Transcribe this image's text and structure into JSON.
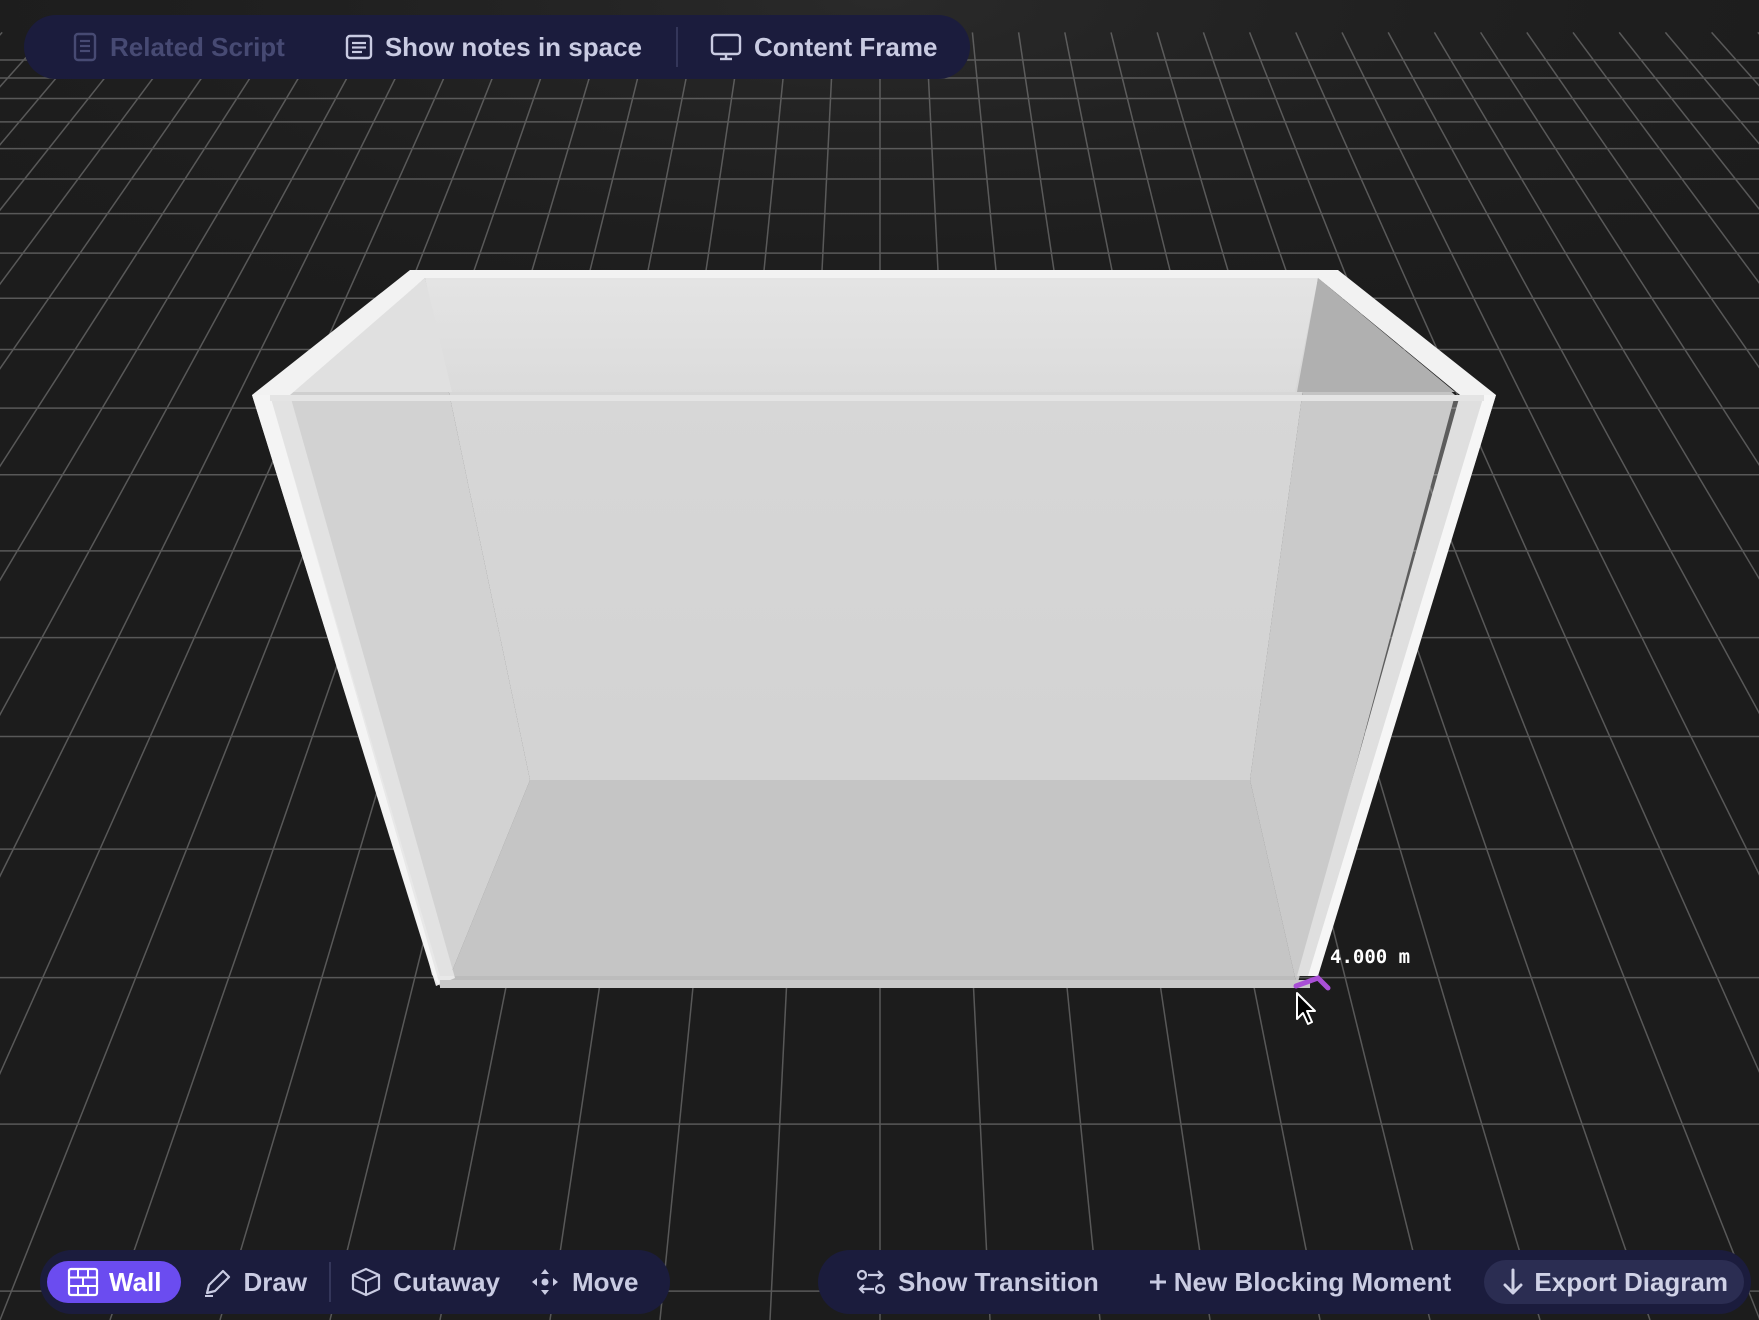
{
  "top_toolbar": {
    "related_script": "Related Script",
    "show_notes": "Show notes in space",
    "content_frame": "Content Frame"
  },
  "scene": {
    "measurement": "4.000 m",
    "accent_color": "#a94fd6"
  },
  "bottom_left_toolbar": {
    "wall": "Wall",
    "draw": "Draw",
    "cutaway": "Cutaway",
    "move": "Move"
  },
  "bottom_right_toolbar": {
    "show_transition": "Show Transition",
    "new_blocking_moment": "New Blocking Moment",
    "export_diagram": "Export Diagram"
  },
  "colors": {
    "toolbar_bg": "#1b1c3d",
    "active_pill": "#6b4cf0",
    "grid_line": "#8a8a8a",
    "background": "#1c1c1c"
  },
  "icons": {
    "related_script": "document-icon",
    "show_notes": "notes-list-icon",
    "content_frame": "monitor-icon",
    "wall": "brick-wall-icon",
    "draw": "pencil-icon",
    "cutaway": "cube-cutaway-icon",
    "move": "move-arrows-icon",
    "show_transition": "transition-icon",
    "new_blocking_moment": "plus-icon",
    "export_diagram": "arrow-down-icon"
  }
}
